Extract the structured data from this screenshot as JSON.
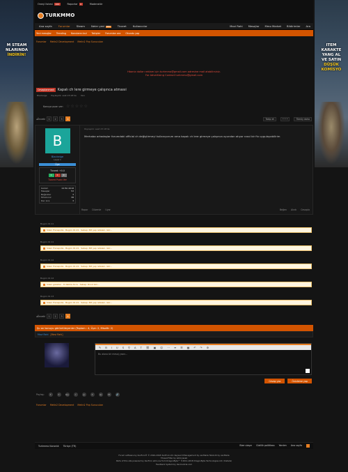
{
  "ads": {
    "left_lines": [
      "M STEAM",
      "NLARINDA",
      "İNDİRİN!"
    ],
    "right_lines": [
      "ITEM",
      "KARAKTE",
      "YANG AL",
      "VE SATIN",
      "DÜŞÜK",
      "KOMİSYO"
    ]
  },
  "topbar": {
    "items": [
      "Oneçi listesi",
      "Raporlar",
      "Moderatör"
    ],
    "badges": [
      "100",
      "0"
    ]
  },
  "logo": {
    "text": "TURKMMO"
  },
  "nav": {
    "items": [
      "Ana sayfa",
      "Forumlar",
      "Steam",
      "Neler yeni",
      "Ticaret",
      "Kullanıcılar"
    ],
    "new_badge": "NEW",
    "right": [
      "Mavi Rahi",
      "Mesajlar",
      "Mmo Market",
      "Bildirimler",
      "Ara"
    ]
  },
  "subnav": {
    "items": [
      "Yeni mesajlar",
      "Trending",
      "Konularını bul",
      "Takipler",
      "Forumları ara",
      "Okundu yap"
    ]
  },
  "breadcrumb": [
    "Forumlar",
    "Metin2 Development",
    "Metin2 Pvp Sunucuları"
  ],
  "notice": {
    "line1": "Hbaniz dolları reklam için turkmmo@gmail.com adresine mail atabilirsiniz.",
    "line2": "For Advertising Contact turkmmo@gmail.com"
  },
  "thread": {
    "prefix": "Cevaplanmadı",
    "title": "Kapalı ch lere girmeye çalışınca atmasıi",
    "meta": [
      "Blackeige",
      "Paylaşıldı: saat 23:18'de",
      "Yeni"
    ]
  },
  "rating": {
    "label": "Konuya puan ver:",
    "stars": [
      "☆",
      "☆",
      "☆",
      "☆",
      "☆"
    ]
  },
  "pager": {
    "prev": "◂Önceki",
    "pages": [
      "1",
      "2",
      "3",
      "4"
    ],
    "tools": [
      "Takip et",
      "• • •",
      "Tümüy daha"
    ]
  },
  "post": {
    "avatar_letter": "B",
    "username": "Blackeige",
    "level": "Level 1",
    "role": "Üye",
    "trade_label": "Ticaret: +0.0",
    "trade_boxes": [
      "0",
      "0",
      "0"
    ],
    "trade_link": "Ticaret Puanı Ver",
    "stats": [
      {
        "k": "Katılım",
        "v": "19 Eki 2018"
      },
      {
        "k": "Mesajlar",
        "v": "53"
      },
      {
        "k": "Beğeniler",
        "v": "3"
      },
      {
        "k": "Mmoloroz",
        "v": "38"
      },
      {
        "k": "Dec Lira",
        "v": "3"
      }
    ],
    "date": "Paylaşıldı: saat 23:18'de",
    "message": "Merhaba arkadaşlar forumdaki official ch değiştirmeyi kullanıyorum ama kapalı ch lere girmeye çalışınca oyundan atıyor nasıl bir fix uygulayabilirim",
    "actions": [
      "Rapor",
      "Düzenle",
      "Uyar"
    ],
    "actions_right": [
      "Beğen",
      "Alıntı",
      "Cevapla"
    ]
  },
  "comments": [
    {
      "time": "Bugün 01:11",
      "text": "Sileni Transpolle · Bugün 01:21 · Sebep: MZ yep retaleni. Gör..."
    },
    {
      "time": "Bugün 01:11",
      "text": "Sileni Transpolle · Bugün 01:21 · Sebep: MZ yep retaleni. Gör..."
    },
    {
      "time": "Bugün 01:12",
      "text": "Sileni Transpolle · Bugün 01:21 · Sebep: MZ yep retaleni. Gör..."
    },
    {
      "time": "Bugün 01:12",
      "text": "Sileni güzeller · 8 dakika önce · Sebep: Rnod Gör..."
    },
    {
      "time": "Bugün 01:13",
      "text": "Sileni Transpolle · Bugün 01:21 · Sebep: MZ yep retaleni. Gör..."
    }
  ],
  "viewers": {
    "title": "Şu an konuyu görüntüleyenler (Toplam : 4, Üye: 2, Misafir: 2)",
    "names": [
      "Mavi Rahi",
      "[Mavi Rahi]"
    ]
  },
  "reply": {
    "placeholder": "Bu alana bir mesaj yazın...",
    "buttons": [
      "Cevap yaz",
      "Önizleme yap"
    ],
    "toolbar": [
      "✎",
      "B",
      "I",
      "U",
      "S",
      "⚲",
      "A",
      "T",
      "⛓",
      "▣",
      "☺",
      "⋯",
      "≡",
      "☰",
      "▦",
      "↶",
      "↷",
      "⚙"
    ]
  },
  "share": {
    "label": "Paylaş:",
    "icons": [
      "f",
      "t",
      "G+",
      "r",
      "p",
      "t",
      "w",
      "✉",
      "🔗"
    ]
  },
  "footer": {
    "left": [
      "Turkmmo Karanlık",
      "Türkçe (TR)"
    ],
    "right": [
      "Bize ulaşın",
      "Gizlilik politikası",
      "Yardım",
      "Ana sayfa"
    ]
  },
  "credits": [
    "Forum software by XenForo® © 2010-2018 XenForo Ltd. Keyword Management by xenMade TaCoLtd by xenMade",
    "Thread Filter by AddonsLab",
    "Parts of this site powered by XenForo add-ons from DragonByte™ ©2011-2018 DragonByte Technologies Ltd. (Details)",
    "Feedback System by XenCentral.com"
  ]
}
